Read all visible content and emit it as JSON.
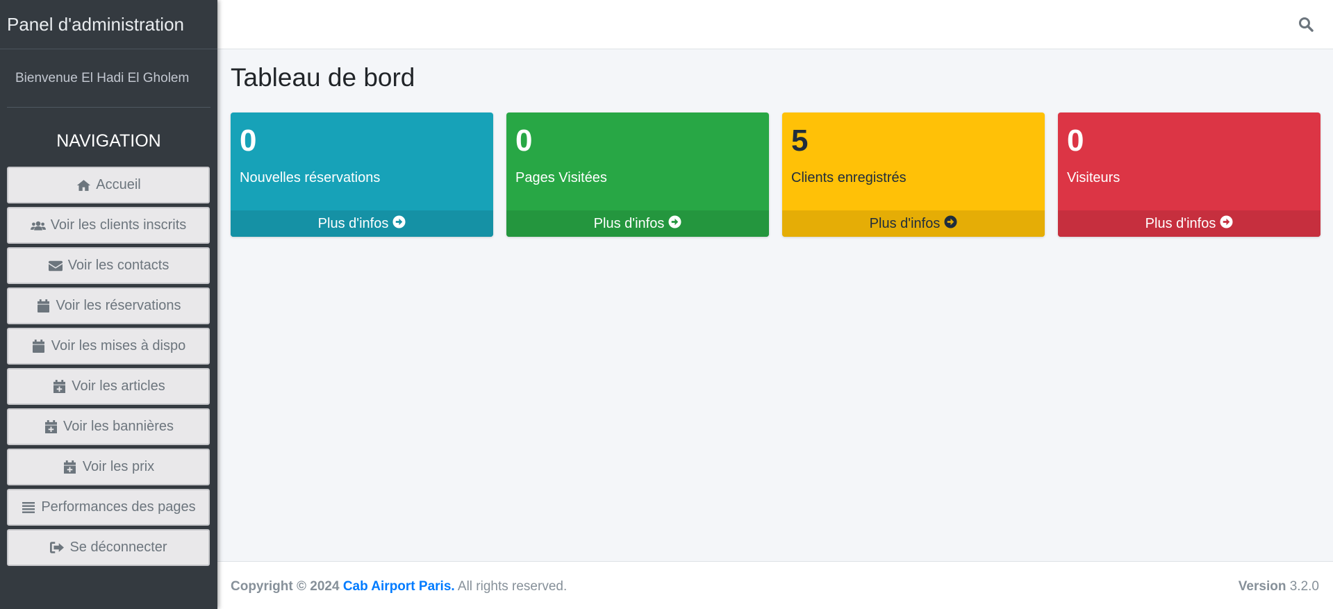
{
  "sidebar": {
    "brand": "Panel d'administration",
    "welcome": "Bienvenue El Hadi El Gholem",
    "nav_title": "NAVIGATION",
    "items": [
      {
        "label": "Accueil",
        "icon": "home-icon"
      },
      {
        "label": "Voir les clients inscrits",
        "icon": "users-icon"
      },
      {
        "label": "Voir les contacts",
        "icon": "envelope-icon"
      },
      {
        "label": "Voir les réservations",
        "icon": "calendar-icon"
      },
      {
        "label": "Voir les mises à dispo",
        "icon": "calendar-icon"
      },
      {
        "label": "Voir les articles",
        "icon": "calendar-plus-icon"
      },
      {
        "label": "Voir les bannières",
        "icon": "calendar-plus-icon"
      },
      {
        "label": "Voir les prix",
        "icon": "calendar-plus-icon"
      },
      {
        "label": "Performances des pages",
        "icon": "bars-icon"
      },
      {
        "label": "Se déconnecter",
        "icon": "sign-out-icon"
      }
    ]
  },
  "topbar": {
    "search_icon": "search-icon"
  },
  "main": {
    "title": "Tableau de bord",
    "cards": [
      {
        "value": "0",
        "label": "Nouvelles réservations",
        "link": "Plus d'infos",
        "color": "#17a2b8"
      },
      {
        "value": "0",
        "label": "Pages Visitées",
        "link": "Plus d'infos",
        "color": "#28a745"
      },
      {
        "value": "5",
        "label": "Clients enregistrés",
        "link": "Plus d'infos",
        "color": "#ffc107"
      },
      {
        "value": "0",
        "label": "Visiteurs",
        "link": "Plus d'infos",
        "color": "#dc3545"
      }
    ]
  },
  "footer": {
    "copyright": "Copyright © 2024",
    "company": "Cab Airport Paris.",
    "rights": "All rights reserved.",
    "version_label": "Version",
    "version_value": "3.2.0"
  }
}
